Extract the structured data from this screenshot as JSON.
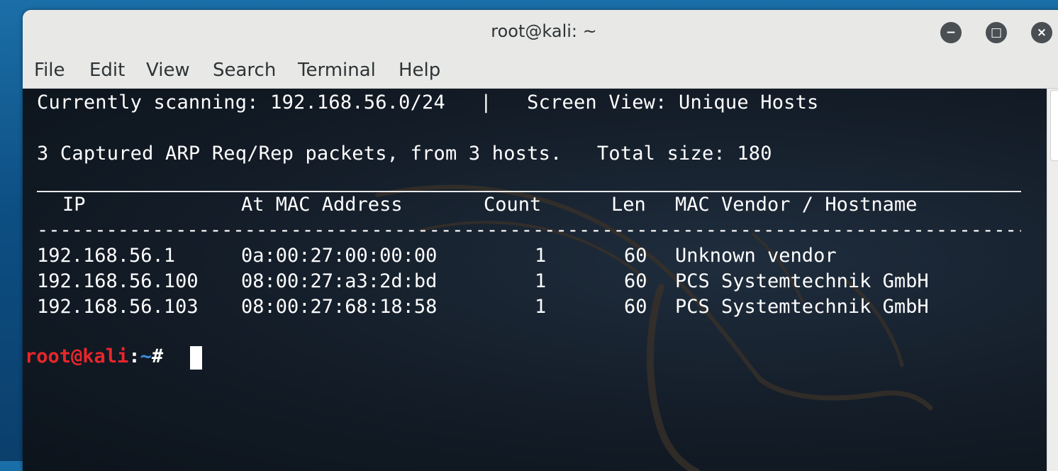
{
  "window": {
    "title": "root@kali: ~",
    "controls": {
      "minimize": "−",
      "maximize": "□",
      "close": "×"
    }
  },
  "menu": [
    "File",
    "Edit",
    "View",
    "Search",
    "Terminal",
    "Help"
  ],
  "terminal": {
    "status_line": "Currently scanning: 192.168.56.0/24   |   Screen View: Unique Hosts",
    "summary_line": "3 Captured ARP Req/Rep packets, from 3 hosts.   Total size: 180",
    "columns": [
      "IP",
      "At MAC Address",
      "Count",
      "Len",
      "MAC Vendor / Hostname"
    ],
    "dashes": "------------------------------------------------------------------------------------------------",
    "rows": [
      {
        "ip": "192.168.56.1",
        "mac": "0a:00:27:00:00:00",
        "count": "1",
        "len": "60",
        "vendor": "Unknown vendor"
      },
      {
        "ip": "192.168.56.100",
        "mac": "08:00:27:a3:2d:bd",
        "count": "1",
        "len": "60",
        "vendor": "PCS Systemtechnik GmbH"
      },
      {
        "ip": "192.168.56.103",
        "mac": "08:00:27:68:18:58",
        "count": "1",
        "len": "60",
        "vendor": "PCS Systemtechnik GmbH"
      }
    ],
    "prompt": {
      "user_host": "root@kali",
      "colon": ":",
      "path": "~",
      "symbol": "# "
    }
  },
  "colors": {
    "prompt_user": "#e8262b",
    "prompt_path": "#3b8fe0",
    "terminal_bg": "#131c27",
    "titlebar_bg": "#e8e8e7"
  }
}
